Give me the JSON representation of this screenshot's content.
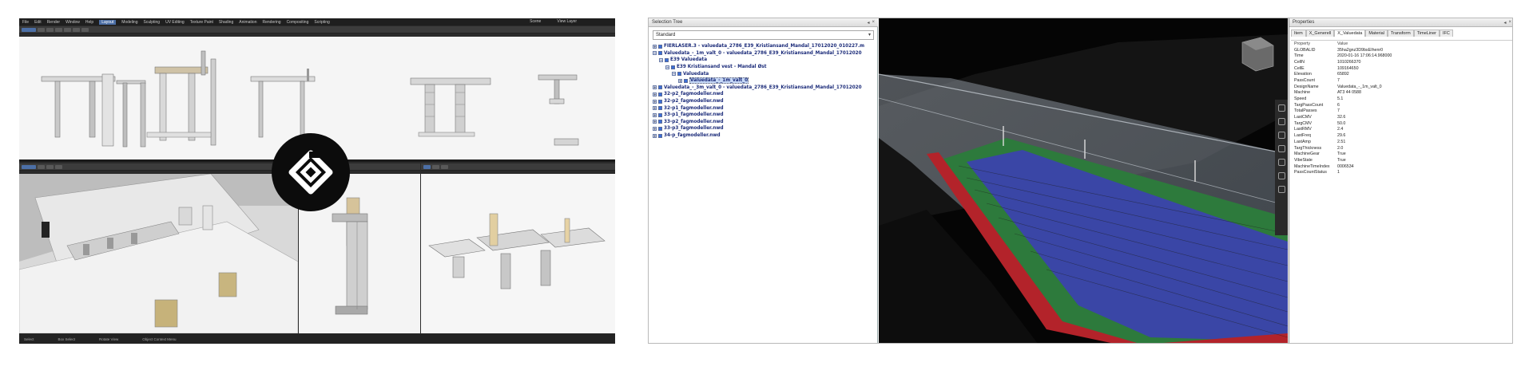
{
  "left_app": {
    "menu": [
      "File",
      "Edit",
      "Render",
      "Window",
      "Help"
    ],
    "workspace_tabs": [
      "Layout",
      "Modeling",
      "Sculpting",
      "UV Editing",
      "Texture Paint",
      "Shading",
      "Animation",
      "Rendering",
      "Compositing",
      "Scripting"
    ],
    "active_workspace": "Layout",
    "scene_label": "Scene",
    "view_layer_label": "View Layer",
    "viewport_mode": "Object Mode",
    "header_items": [
      "View",
      "Select",
      "Add",
      "Object"
    ],
    "status_left": [
      "Select",
      "Box Select"
    ],
    "status_mid": "Rotate View",
    "status_right": "Object Context Menu"
  },
  "logo": {
    "icon": "diamond-logo-icon",
    "bg_color": "#0c0c0c",
    "fg_color": "#ffffff"
  },
  "right_app": {
    "selection_tree_title": "Selection Tree",
    "selection_tree_dropdown": "Standard",
    "tree_items": [
      {
        "label": "FIERLASER.3 - valuedata_2786_E39_Kristiansand_Mandal_17012020_010227.m",
        "depth": 0,
        "selected": false
      },
      {
        "label": "Valuedata_-_1m_valt_0 - valuedata_2786_E39_Kristiansand_Mandal_17012020",
        "depth": 0,
        "selected": false
      },
      {
        "label": "E39 Valuedata",
        "depth": 1,
        "selected": false
      },
      {
        "label": "E39 Kristiansand vest - Mandal Øst",
        "depth": 2,
        "selected": false
      },
      {
        "label": "Valuedata",
        "depth": 3,
        "selected": false
      },
      {
        "label": "Valuedata_-_1m_valt_0",
        "depth": 4,
        "selected": true
      },
      {
        "label": "Valuedata_-_3m_valt_0 - valuedata_2786_E39_Kristiansand_Mandal_17012020",
        "depth": 0,
        "selected": false
      },
      {
        "label": "32-p2_fagmodeller.nwd",
        "depth": 0,
        "selected": false
      },
      {
        "label": "32-p2_fagmodeller.nwd",
        "depth": 0,
        "selected": false
      },
      {
        "label": "32-p1_fagmodeller.nwd",
        "depth": 0,
        "selected": false
      },
      {
        "label": "33-p1_fagmodeller.nwd",
        "depth": 0,
        "selected": false
      },
      {
        "label": "33-p2_fagmodeller.nwd",
        "depth": 0,
        "selected": false
      },
      {
        "label": "33-p3_fagmodeller.nwd",
        "depth": 0,
        "selected": false
      },
      {
        "label": "34-p_fagmodeller.nwd",
        "depth": 0,
        "selected": false
      }
    ],
    "properties_title": "Properties",
    "tabs": [
      "Item",
      "X_Generell",
      "X_Valuedata",
      "Material",
      "Transform",
      "TimeLiner",
      "IFC"
    ],
    "active_tab": "X_Valuedata",
    "table_header": {
      "k": "Property",
      "v": "Value"
    },
    "properties": [
      {
        "k": "GLOBALID",
        "v": "35ha2gnz3D9bsEIhenr0"
      },
      {
        "k": "Time",
        "v": "2020-01-16 17:06:14.968000"
      },
      {
        "k": "CellN",
        "v": "1010266370"
      },
      {
        "k": "CellE",
        "v": "109164650"
      },
      {
        "k": "Elevation",
        "v": "65892"
      },
      {
        "k": "PassCount",
        "v": "7"
      },
      {
        "k": "DesignName",
        "v": "Valuedata_-_1m_valt_0"
      },
      {
        "k": "Machine",
        "v": "AT3 44 0588"
      },
      {
        "k": "Speed",
        "v": "5.1"
      },
      {
        "k": "TargPassCount",
        "v": "6"
      },
      {
        "k": "TotalPasses",
        "v": "7"
      },
      {
        "k": "LastCMV",
        "v": "32.6"
      },
      {
        "k": "TargCMV",
        "v": "50.0"
      },
      {
        "k": "LastRMV",
        "v": "2.4"
      },
      {
        "k": "LastFreq",
        "v": "29.6"
      },
      {
        "k": "LastAmp",
        "v": "2.51"
      },
      {
        "k": "TargThickness",
        "v": "2.0"
      },
      {
        "k": "MachineGear",
        "v": "True"
      },
      {
        "k": "VibeState",
        "v": "True"
      },
      {
        "k": "MachineTimeIndex",
        "v": "0006534"
      },
      {
        "k": "PassCountStatus",
        "v": "1"
      }
    ]
  }
}
